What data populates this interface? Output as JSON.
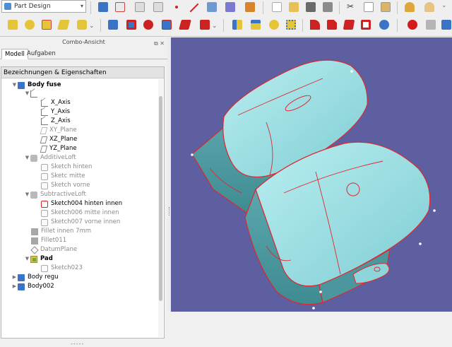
{
  "toolbar": {
    "workbench": "Part Design"
  },
  "panel": {
    "title": "Combo-Ansicht",
    "tabs": [
      {
        "label": "Modell",
        "active": true
      },
      {
        "label": "Aufgaben",
        "active": false
      }
    ],
    "tree_header": "Bezeichnungen & Eigenschaften"
  },
  "tree": {
    "items": [
      {
        "label": "Body fuse"
      },
      {
        "label": "X_Axis"
      },
      {
        "label": "Y_Axis"
      },
      {
        "label": "Z_Axis"
      },
      {
        "label": "XY_Plane"
      },
      {
        "label": "XZ_Plane"
      },
      {
        "label": "YZ_Plane"
      },
      {
        "label": "AdditiveLoft"
      },
      {
        "label": "Sketch hinten"
      },
      {
        "label": "Sketc mitte"
      },
      {
        "label": "Sketch vorne"
      },
      {
        "label": "SubtractiveLoft"
      },
      {
        "label": "Sketch004 hinten innen"
      },
      {
        "label": "Sketch006 mitte innen"
      },
      {
        "label": "Sketch007 vorne innen"
      },
      {
        "label": "Fillet innen 7mm"
      },
      {
        "label": "Fillet011"
      },
      {
        "label": "DatumPlane"
      },
      {
        "label": "Pad"
      },
      {
        "label": "Sketch023"
      },
      {
        "label": "Body regu"
      },
      {
        "label": "Body002"
      }
    ]
  },
  "colors": {
    "viewport_bg": "#5d5fa0",
    "model_face": "#8fd7dd",
    "model_edge": "#e0262f",
    "accent": "#3b74c4"
  },
  "icons": [
    "new-file-icon",
    "open-icon",
    "save-icon",
    "undo-icon",
    "redo-icon",
    "cut-icon",
    "copy-icon",
    "paste-icon",
    "sketch-icon",
    "pad-icon",
    "pocket-icon",
    "fillet-icon",
    "record-macro-icon",
    "stop-macro-icon"
  ]
}
